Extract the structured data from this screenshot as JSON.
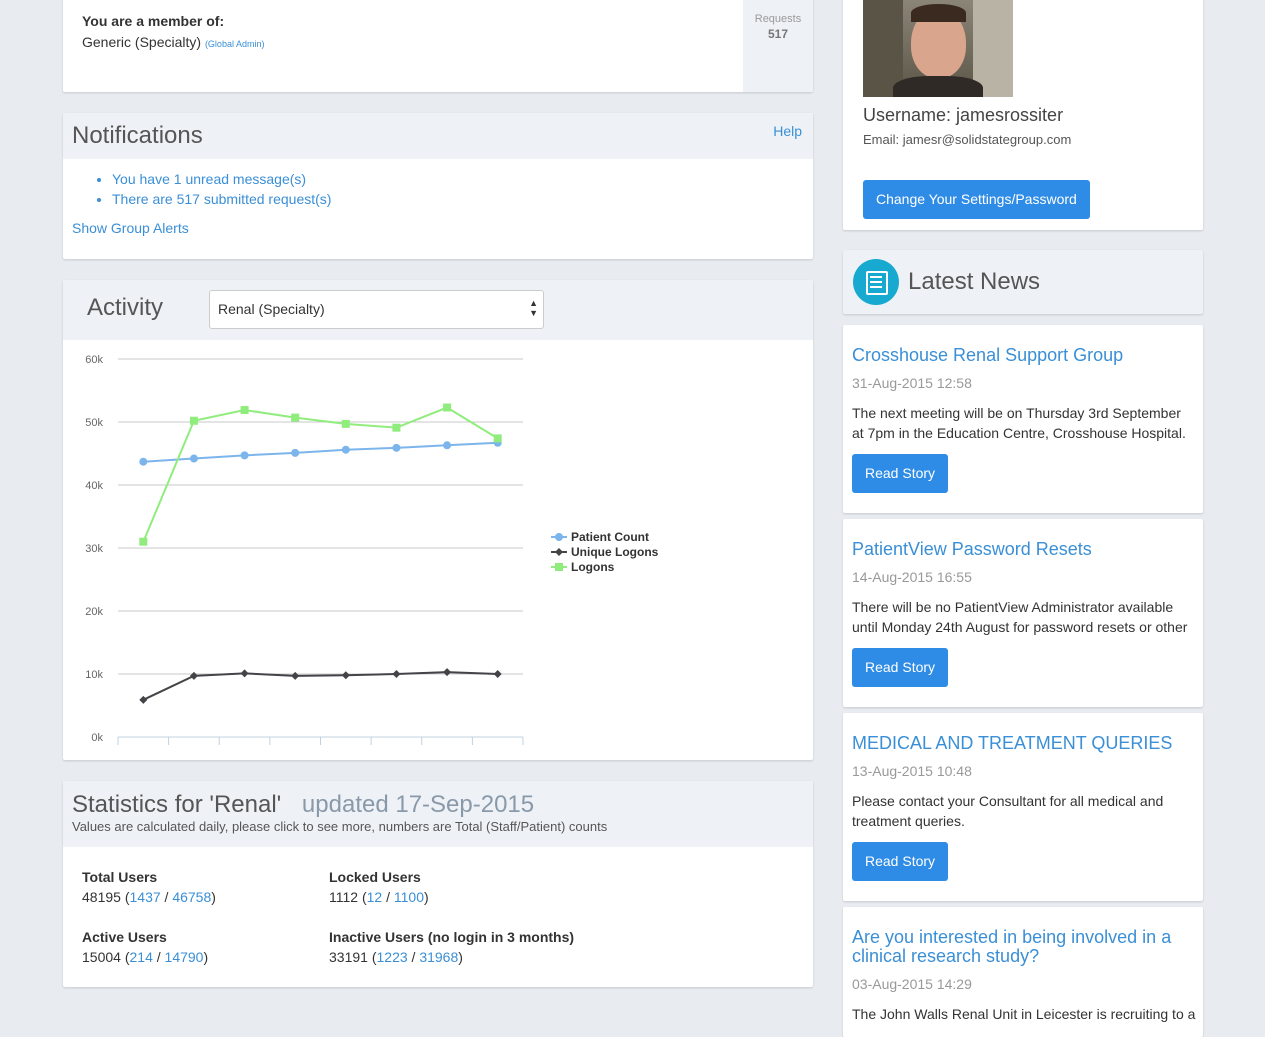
{
  "membership": {
    "label": "You are a member of:",
    "group": "Generic (Specialty)",
    "role": "(Global Admin)",
    "requests_label": "Requests",
    "requests_count": "517"
  },
  "notifications": {
    "title": "Notifications",
    "help": "Help",
    "items": [
      "You have 1 unread message(s)",
      "There are 517 submitted request(s)"
    ],
    "show_group_alerts": "Show Group Alerts"
  },
  "activity": {
    "title": "Activity",
    "select_value": "Renal  (Specialty)"
  },
  "chart_data": {
    "type": "line",
    "x": [
      1,
      2,
      3,
      4,
      5,
      6,
      7,
      8
    ],
    "ylim": [
      0,
      60000
    ],
    "yticks": [
      "0k",
      "10k",
      "20k",
      "30k",
      "40k",
      "50k",
      "60k"
    ],
    "grid": true,
    "legend_position": "right",
    "series": [
      {
        "name": "Patient Count",
        "color": "#7cb5ec",
        "marker": "circle",
        "values": [
          43700,
          44200,
          44700,
          45100,
          45600,
          45900,
          46300,
          46700
        ]
      },
      {
        "name": "Unique Logons",
        "color": "#434348",
        "marker": "diamond",
        "values": [
          5900,
          9700,
          10100,
          9700,
          9800,
          10000,
          10300,
          10000
        ]
      },
      {
        "name": "Logons",
        "color": "#90ed7d",
        "marker": "square",
        "values": [
          31000,
          50200,
          51900,
          50700,
          49700,
          49100,
          52300,
          47400
        ]
      }
    ]
  },
  "statistics": {
    "title": "Statistics for 'Renal'",
    "updated": "updated 17-Sep-2015",
    "subtitle": "Values are calculated daily, please click to see more, numbers are Total (Staff/Patient) counts",
    "cells": [
      {
        "label": "Total Users",
        "total": "48195",
        "staff": "1437",
        "patient": "46758"
      },
      {
        "label": "Locked Users",
        "total": "1112",
        "staff": "12",
        "patient": "1100"
      },
      {
        "label": "Active Users",
        "total": "15004",
        "staff": "214",
        "patient": "14790"
      },
      {
        "label": "Inactive Users (no login in 3 months)",
        "total": "33191",
        "staff": "1223",
        "patient": "31968"
      }
    ]
  },
  "profile": {
    "username": "Username: jamesrossiter",
    "email": "Email: jamesr@solidstategroup.com",
    "settings_button": "Change Your Settings/Password"
  },
  "news": {
    "header": "Latest News",
    "icon": "newspaper-icon",
    "accent": "#17a9cf",
    "read_story": "Read Story",
    "items": [
      {
        "title": "Crosshouse Renal Support Group",
        "date": "31-Aug-2015 12:58",
        "body": "The next meeting will be on Thursday 3rd September at 7pm in the Education Centre, Crosshouse Hospital."
      },
      {
        "title": "PatientView Password Resets",
        "date": "14-Aug-2015 16:55",
        "body": "There will be no PatientView Administrator available until Monday 24th August for password resets or other"
      },
      {
        "title": "MEDICAL AND TREATMENT QUERIES",
        "date": "13-Aug-2015 10:48",
        "body": "Please contact your Consultant for all medical and treatment queries."
      },
      {
        "title": "Are you interested in being involved in a clinical research study?",
        "date": "03-Aug-2015 14:29",
        "body": "The John Walls Renal Unit in Leicester is recruiting to a"
      }
    ]
  }
}
